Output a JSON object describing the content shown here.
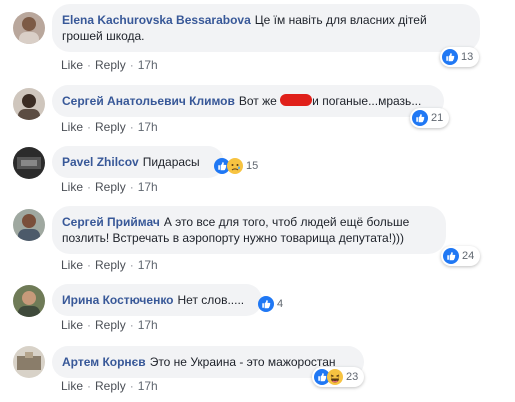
{
  "comments": [
    {
      "author": "Elena Kachurovska Bessarabova",
      "text_line1": "Це їм навіть для власних дітей",
      "text_line2": "грошей шкода.",
      "like": "Like",
      "reply": "Reply",
      "time": "17h",
      "reaction_count": "13",
      "reactions": [
        "like-icon"
      ]
    },
    {
      "author": "Сергей Анатольевич Климов",
      "text_before": "Вот же",
      "text_after": "и поганые...мразь...",
      "like": "Like",
      "reply": "Reply",
      "time": "17h",
      "reaction_count": "21",
      "reactions": [
        "like-icon"
      ]
    },
    {
      "author": "Pavel Zhilcov",
      "text": "Пидарасы",
      "like": "Like",
      "reply": "Reply",
      "time": "17h",
      "reaction_count": "15",
      "reactions": [
        "like-icon",
        "sad-icon"
      ]
    },
    {
      "author": "Сергей Приймач",
      "text_line1": "А это все для того, чтоб людей ещё больше",
      "text_line2": "позлить! Встречать в аэропорту нужно товарища депутата!)))",
      "like": "Like",
      "reply": "Reply",
      "time": "17h",
      "reaction_count": "24",
      "reactions": [
        "like-icon"
      ]
    },
    {
      "author": "Ирина Костюченко",
      "text": "Нет слов.....",
      "like": "Like",
      "reply": "Reply",
      "time": "17h",
      "reaction_count": "4",
      "reactions": [
        "like-icon"
      ]
    },
    {
      "author": "Артем Корнєв",
      "text": "Это не Украина - это мажоростан",
      "like": "Like",
      "reply": "Reply",
      "time": "17h",
      "reaction_count": "23",
      "reactions": [
        "like-icon",
        "haha-icon"
      ]
    }
  ],
  "colors": {
    "author": "#385898",
    "bubble": "#f2f3f5",
    "like_blue": "#2078f4",
    "redaction": "#e0201a"
  }
}
